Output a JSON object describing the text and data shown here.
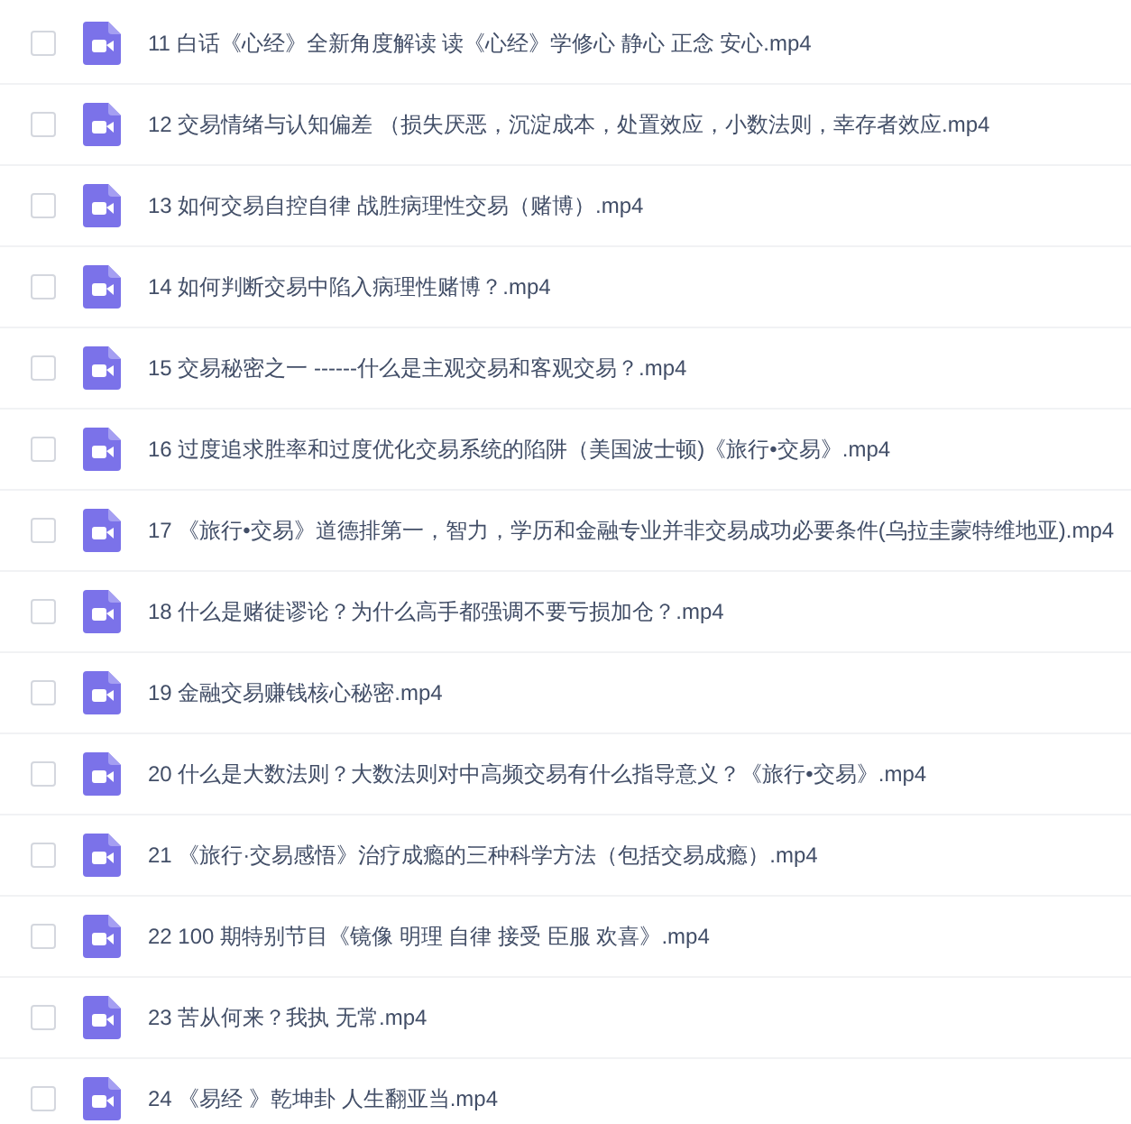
{
  "files": [
    {
      "name": "11 白话《心经》全新角度解读 读《心经》学修心 静心 正念 安心.mp4",
      "checked": false
    },
    {
      "name": "12 交易情绪与认知偏差 （损失厌恶，沉淀成本，处置效应，小数法则，幸存者效应.mp4",
      "checked": false
    },
    {
      "name": "13 如何交易自控自律 战胜病理性交易（赌博）.mp4",
      "checked": false
    },
    {
      "name": "14 如何判断交易中陷入病理性赌博？.mp4",
      "checked": false
    },
    {
      "name": "15 交易秘密之一 ------什么是主观交易和客观交易？.mp4",
      "checked": false
    },
    {
      "name": "16 过度追求胜率和过度优化交易系统的陷阱（美国波士顿)《旅行•交易》.mp4",
      "checked": false
    },
    {
      "name": "17 《旅行•交易》道德排第一，智力，学历和金融专业并非交易成功必要条件(乌拉圭蒙特维地亚).mp4",
      "checked": false
    },
    {
      "name": "18 什么是赌徒谬论？为什么高手都强调不要亏损加仓？.mp4",
      "checked": false
    },
    {
      "name": "19 金融交易赚钱核心秘密.mp4",
      "checked": false
    },
    {
      "name": "20 什么是大数法则？大数法则对中高频交易有什么指导意义？《旅行•交易》.mp4",
      "checked": false
    },
    {
      "name": "21 《旅行·交易感悟》治疗成瘾的三种科学方法（包括交易成瘾）.mp4",
      "checked": false
    },
    {
      "name": "22 100 期特别节目《镜像 明理 自律 接受 臣服 欢喜》.mp4",
      "checked": false
    },
    {
      "name": "23 苦从何来？我执 无常.mp4",
      "checked": false
    },
    {
      "name": "24 《易经 》乾坤卦 人生翻亚当.mp4",
      "checked": false
    }
  ]
}
